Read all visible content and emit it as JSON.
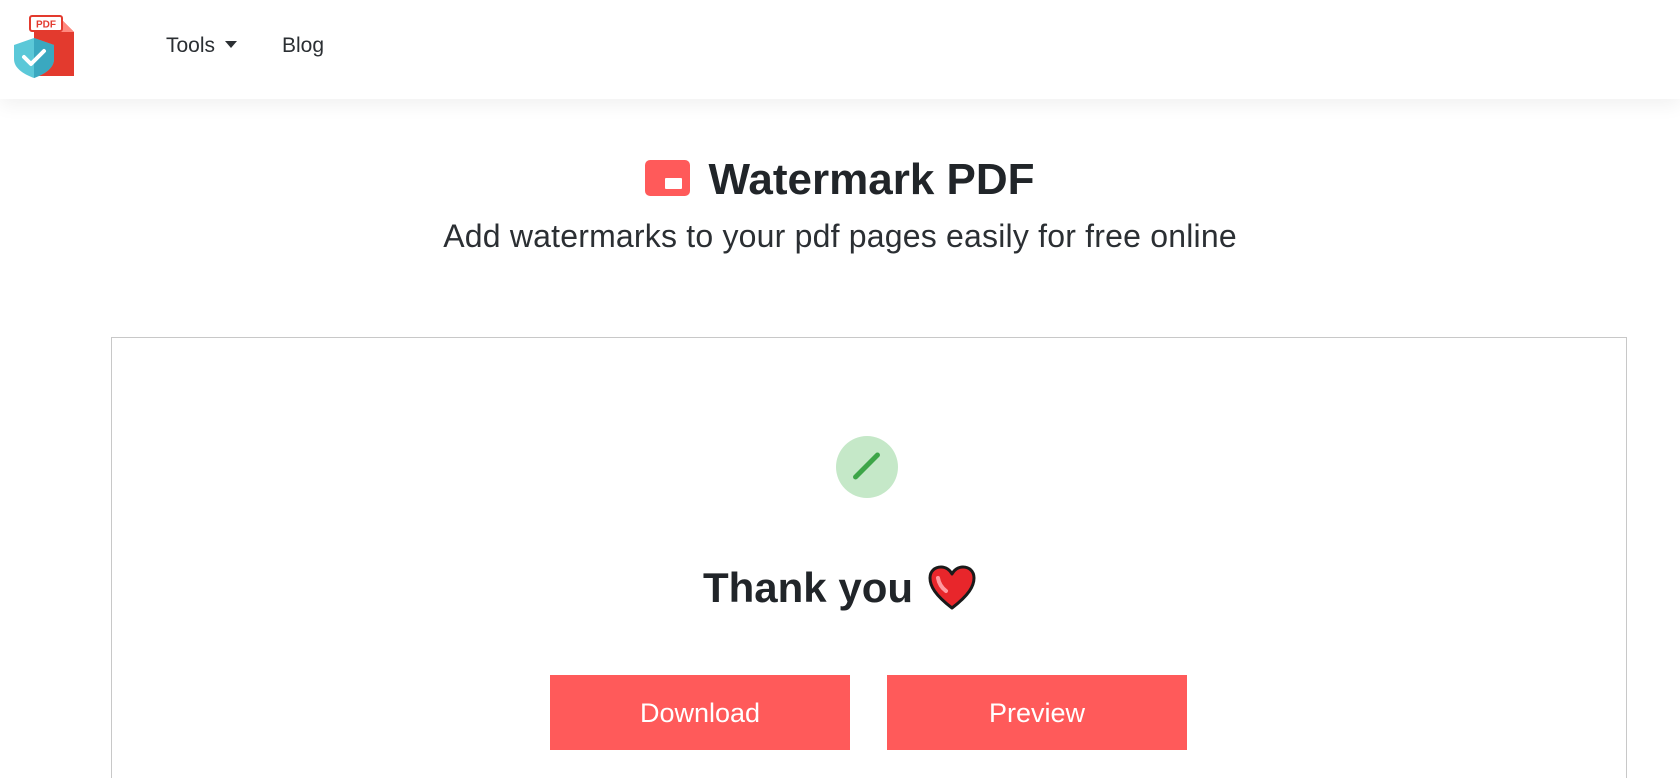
{
  "navbar": {
    "logo_badge_text": "PDF",
    "items": [
      {
        "label": "Tools"
      },
      {
        "label": "Blog"
      }
    ]
  },
  "hero": {
    "title": "Watermark PDF",
    "subtitle": "Add watermarks to your pdf pages easily for free online"
  },
  "result": {
    "message": "Thank you",
    "download_label": "Download",
    "preview_label": "Preview"
  },
  "colors": {
    "accent": "#ff5a5a",
    "success_bg": "#c5e8c8",
    "success_fg": "#3da548",
    "text": "#212529"
  },
  "icons": {
    "logo": "pdf-shield-logo-icon",
    "title": "watermark-icon",
    "status": "success-check-icon",
    "heart": "heart-icon"
  }
}
